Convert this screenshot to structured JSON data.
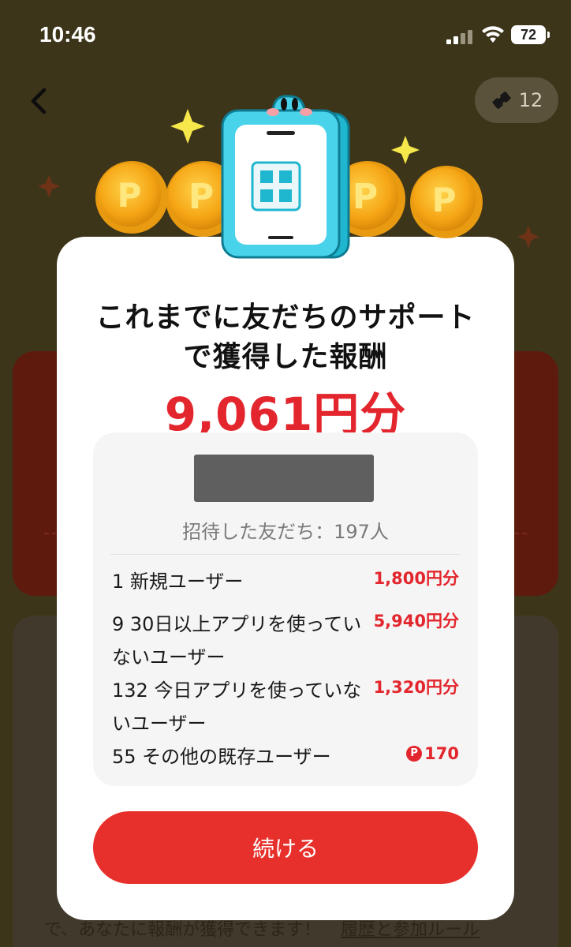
{
  "status_bar": {
    "time": "10:46",
    "battery": "72"
  },
  "header": {
    "ticket_count": "12"
  },
  "modal": {
    "title_line1": "これまでに友だちのサポート",
    "title_line2": "で獲得した報酬",
    "amount": "9,061円分",
    "invite_count": "招待した友だち：197人",
    "rows": [
      {
        "label": "1 新規ユーザー",
        "value": "1,800円分",
        "points": false
      },
      {
        "label": "9 30日以上アプリを使っていないユーザー",
        "value": "5,940円分",
        "points": false
      },
      {
        "label": "132 今日アプリを使っていないユーザー",
        "value": "1,320円分",
        "points": false
      },
      {
        "label": "55 その他の既存ユーザー",
        "value": "170",
        "points": true
      }
    ],
    "continue_label": "続ける"
  },
  "background": {
    "footer_text": "で、あなたに報酬が獲得できます！",
    "footer_link": "履歴と参加ルール"
  },
  "colors": {
    "accent_red": "#e3262d",
    "button_red": "#e7302b",
    "overlay": "#3d351a"
  },
  "icons": [
    "back-chevron-icon",
    "ticket-icon",
    "signal-icon",
    "wifi-icon",
    "battery-icon",
    "coin-icon",
    "phone-mascot-icon",
    "sparkle-icon",
    "p-points-icon"
  ]
}
